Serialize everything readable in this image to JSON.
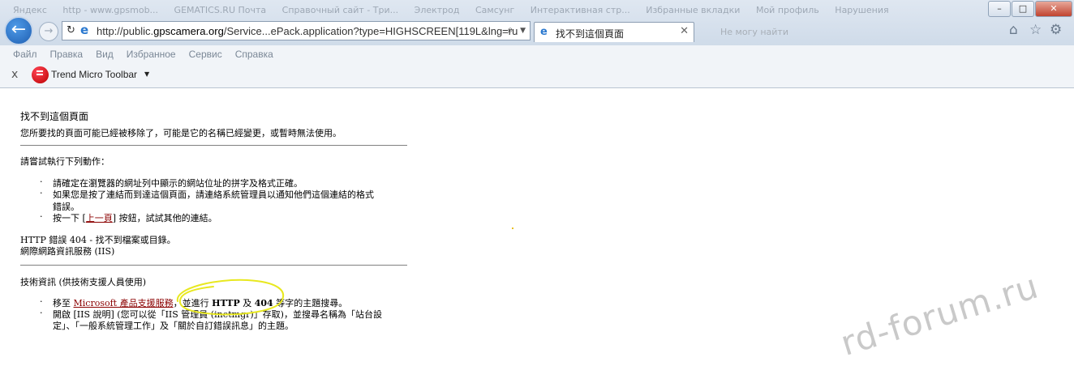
{
  "browser": {
    "favorites": [
      "Яндекс",
      "http - www.gpsmob...",
      "GEMATICS.RU Почта",
      "Справочный сайт - Три...",
      "Электрод",
      "Самсунг",
      "Интерактивная стр...",
      "Избранные вкладки",
      "Мой профиль",
      "Нарушения"
    ],
    "window_controls": {
      "minimize": "–",
      "maximize": "□",
      "close": "✕"
    },
    "address_prefix": "http://public.",
    "address_domain": "gpscamera.org",
    "address_suffix": "/Service...ePack.application?type=HIGHSCREEN[119L&lng=ru",
    "tab_title": "找不到這個頁面",
    "new_tab_ghost": "Не могу найти",
    "icons": [
      "back-arrow-icon",
      "forward-arrow-icon",
      "refresh-icon",
      "ie-logo-icon",
      "search-icon",
      "home-icon",
      "star-icon",
      "gear-icon"
    ]
  },
  "menu": [
    "Файл",
    "Правка",
    "Вид",
    "Избранное",
    "Сервис",
    "Справка"
  ],
  "toolbar": {
    "close": "x",
    "name": "Trend Micro Toolbar"
  },
  "page": {
    "title": "找不到這個頁面",
    "subtitle": "您所要找的頁面可能已經被移除了，可能是它的名稱已經變更，或暫時無法使用。",
    "try_heading": "請嘗試執行下列動作：",
    "try_items": [
      "請確定在瀏覽器的網址列中顯示的網站位址的拼字及格式正確。",
      "如果您是按了連結而到達這個頁面，請連絡系統管理員以通知他們這個連結的格式",
      "錯誤。"
    ],
    "back_prefix": "按一下 [",
    "back_link": "上一頁",
    "back_suffix": "] 按鈕，試試其他的連結。",
    "http_error": "HTTP 錯誤 404 - 找不到檔案或目錄。",
    "iis": "網際網路資訊服務 (IIS)",
    "tech_heading": "技術資訊 (供技術支援人員使用)",
    "tech_item1_prefix": "移至 ",
    "tech_item1_link": "Microsoft 產品支援服務",
    "tech_item1_mid": "，並進行 ",
    "tech_item1_http": "HTTP",
    "tech_item1_and": " 及 ",
    "tech_item1_404": "404",
    "tech_item1_suffix": " 等字的主題搜尋。",
    "tech_item2_line1": "開啟 [IIS 說明] (您可以從「IIS 管理員 (inetmgr)」存取)，並搜尋名稱為「站台設",
    "tech_item2_line2": "定」、「一般系統管理工作」及「關於自訂錯誤訊息」的主題。"
  },
  "watermark": "rd-forum.ru",
  "annotation_color": "#e8e820"
}
